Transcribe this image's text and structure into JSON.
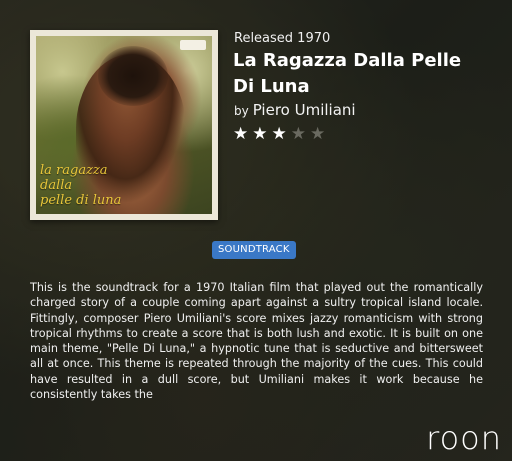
{
  "album": {
    "released": "Released 1970",
    "title": "La Ragazza Dalla Pelle Di Luna",
    "by_label": "by",
    "artist": "Piero Umiliani",
    "rating": 3,
    "rating_max": 5,
    "cover_text": "la ragazza\ndalla\npelle di luna"
  },
  "genre": {
    "tag": "SOUNDTRACK"
  },
  "review": {
    "text": "This is the soundtrack for a 1970 Italian film that played out the romantically charged story of a couple coming apart against a sultry tropical island locale. Fittingly, composer Piero Umiliani's score mixes jazzy romanticism with strong tropical rhythms to create a score that is both lush and exotic. It is built on one main theme, \"Pelle Di Luna,\" a hypnotic tune that is seductive and bittersweet all at once. This theme is repeated through the majority of the cues. This could have resulted in a dull score, but Umiliani makes it work because he consistently takes the"
  },
  "branding": {
    "logo": "roon"
  },
  "colors": {
    "tag_background": "#3a78c6",
    "star_filled": "#ffffff",
    "star_empty": "#6a6a60",
    "cover_text": "#e8c63a"
  }
}
